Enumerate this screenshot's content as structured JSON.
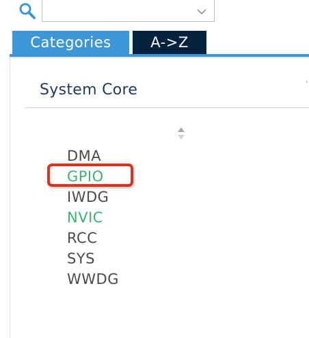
{
  "search": {
    "value": "",
    "placeholder": ""
  },
  "tabs": [
    {
      "label": "Categories",
      "active": true
    },
    {
      "label": "A->Z",
      "active": false
    }
  ],
  "group": {
    "title": "System Core"
  },
  "peripherals": [
    {
      "label": "DMA",
      "enabled": false
    },
    {
      "label": "GPIO",
      "enabled": true,
      "highlighted": true
    },
    {
      "label": "IWDG",
      "enabled": false
    },
    {
      "label": "NVIC",
      "enabled": true
    },
    {
      "label": "RCC",
      "enabled": false
    },
    {
      "label": "SYS",
      "enabled": false
    },
    {
      "label": "WWDG",
      "enabled": false
    }
  ],
  "colors": {
    "tab_active": "#3d96d5",
    "tab_inactive": "#04223d",
    "enabled_text": "#3cb371",
    "default_text": "#4a4a4a",
    "highlight": "#e0311e"
  },
  "icons": {
    "search": "search-icon",
    "dropdown": "chevron-down-icon",
    "sort": "sort-icon"
  }
}
